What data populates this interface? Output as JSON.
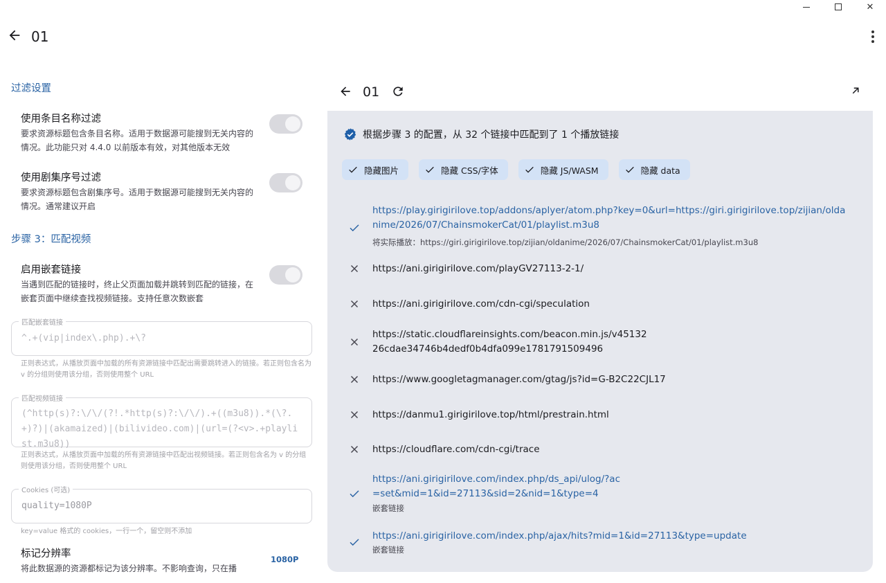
{
  "app": {
    "title": "01"
  },
  "filter": {
    "section_title": "过滤设置",
    "name_filter": {
      "title": "使用条目名称过滤",
      "desc": "要求资源标题包含条目名称。适用于数据源可能搜到无关内容的情况。此功能只对 4.4.0 以前版本有效，对其他版本无效"
    },
    "ep_filter": {
      "title": "使用剧集序号过滤",
      "desc": "要求资源标题包含剧集序号。适用于数据源可能搜到无关内容的情况。通常建议开启"
    }
  },
  "step3": {
    "section_title": "步骤 3：匹配视频",
    "nested": {
      "title": "启用嵌套链接",
      "desc": "当遇到匹配的链接时，终止父页面加载并跳转到匹配的链接，在嵌套页面中继续查找视频链接。支持任意次数嵌套"
    },
    "nested_regex": {
      "label": "匹配嵌套链接",
      "value": "^.+(vip|index\\.php).+\\?",
      "help": "正则表达式，从播放页面中加载的所有资源链接中匹配出需要跳转进入的链接。若正则包含名为 v 的分组则使用该分组，否则使用整个 URL"
    },
    "video_regex": {
      "label": "匹配视频链接",
      "value": "(^http(s)?:\\/\\/(?!.*http(s)?:\\/\\/).+((m3u8)).*(\\?.+)?)|(akamaized)|(bilivideo.com)|(url=(?<v>.+playlist.m3u8))",
      "help": "正则表达式，从播放页面中加载的所有资源链接中匹配出视频链接。若正则包含名为 v 的分组则使用该分组，否则使用整个 URL"
    },
    "cookies": {
      "label": "Cookies (可选)",
      "value": "quality=1080P",
      "help": "key=value 格式的 cookies，一行一个，留空则不添加"
    },
    "resolution": {
      "title": "标记分辨率",
      "desc": "将此数据源的资源都标记为该分辨率。不影响查询，只在播",
      "value": "1080P"
    }
  },
  "web": {
    "title": "01",
    "summary": "根据步骤 3 的配置，从 32 个链接中匹配到了 1 个播放链接",
    "chips": [
      {
        "label": "隐藏图片"
      },
      {
        "label": "隐藏 CSS/字体"
      },
      {
        "label": "隐藏 JS/WASM"
      },
      {
        "label": "隐藏 data"
      }
    ],
    "links": [
      {
        "url": "https://play.girigirilove.top/addons/aplyer/atom.php?key=0&url=https://giri.girigirilove.top/zijian/oldanime/2026/07/ChainsmokerCat/01/playlist.m3u8",
        "status": "matched",
        "sub": "将实际播放：https://giri.girigirilove.top/zijian/oldanime/2026/07/ChainsmokerCat/01/playlist.m3u8"
      },
      {
        "url": "https://ani.girigirilove.com/playGV27113-2-1/",
        "status": "rejected",
        "sub": ""
      },
      {
        "url": "https://ani.girigirilove.com/cdn-cgi/speculation",
        "status": "rejected",
        "sub": ""
      },
      {
        "url": "https://static.cloudflareinsights.com/beacon.min.js/v4513226cdae34746b4dedf0b4dfa099e1781791509496",
        "status": "rejected",
        "sub": ""
      },
      {
        "url": "https://www.googletagmanager.com/gtag/js?id=G-B2C22CJL17",
        "status": "rejected",
        "sub": ""
      },
      {
        "url": "https://danmu1.girigirilove.top/html/prestrain.html",
        "status": "rejected",
        "sub": ""
      },
      {
        "url": "https://cloudflare.com/cdn-cgi/trace",
        "status": "rejected",
        "sub": ""
      },
      {
        "url": "https://ani.girigirilove.com/index.php/ds_api/ulog/?ac=set&mid=1&id=27113&sid=2&nid=1&type=4",
        "status": "matched",
        "sub": "嵌套链接"
      },
      {
        "url": "https://ani.girigirilove.com/index.php/ajax/hits?mid=1&id=27113&type=update",
        "status": "matched",
        "sub": "嵌套链接"
      }
    ]
  },
  "colors": {
    "accent": "#2a63a4",
    "panel_bg": "#e6e8ee",
    "chip_bg": "#d3e2f6",
    "verified": "#1f5fa8"
  }
}
